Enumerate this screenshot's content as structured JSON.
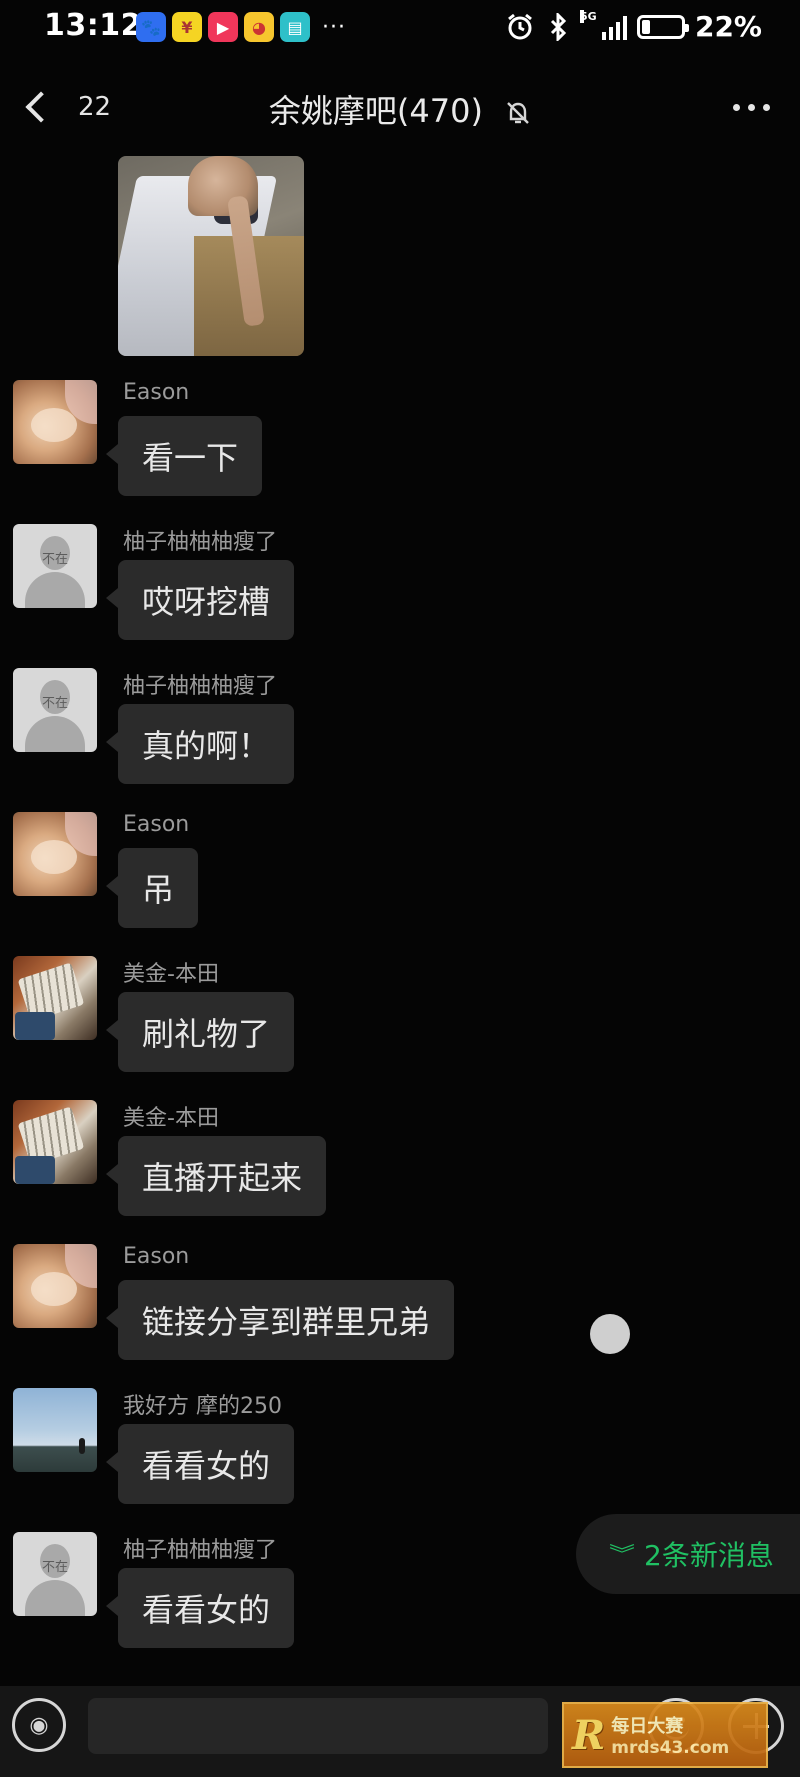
{
  "status_bar": {
    "time": "13:12",
    "battery_percent": "22%",
    "battery_level": 0.22,
    "network": "5G",
    "app_icons": [
      "baidu-app-icon",
      "coupon-app-icon",
      "video-app-icon",
      "duck-app-icon",
      "book-app-icon"
    ],
    "more": "···"
  },
  "header": {
    "back_count": "22",
    "title": "余姚摩吧(470)",
    "muted": true
  },
  "messages": [
    {
      "sender": "Eason",
      "text": "看一下",
      "avatar": "cat"
    },
    {
      "sender": "柚子柚柚柚瘦了",
      "text": "哎呀挖槽",
      "avatar": "default"
    },
    {
      "sender": "柚子柚柚柚瘦了",
      "text": "真的啊！",
      "avatar": "default"
    },
    {
      "sender": "Eason",
      "text": "吊",
      "avatar": "cat"
    },
    {
      "sender": "美金-本田",
      "text": "刷礼物了",
      "avatar": "money"
    },
    {
      "sender": "美金-本田",
      "text": "直播开起来",
      "avatar": "money"
    },
    {
      "sender": "Eason",
      "text": "链接分享到群里兄弟",
      "avatar": "cat"
    },
    {
      "sender": "我好方 摩的250",
      "text": "看看女的",
      "avatar": "sky"
    },
    {
      "sender": "柚子柚柚柚瘦了",
      "text": "看看女的",
      "avatar": "default"
    }
  ],
  "avatar_away_label": "不在",
  "new_messages_label": "2条新消息",
  "input_bar": {
    "placeholder": ""
  },
  "watermark": {
    "logo": "R",
    "line1": "每日大赛",
    "line2": "mrds43.com"
  },
  "colors": {
    "background": "#050505",
    "bubble": "#2b2b2b",
    "accent_green": "#20c063"
  }
}
